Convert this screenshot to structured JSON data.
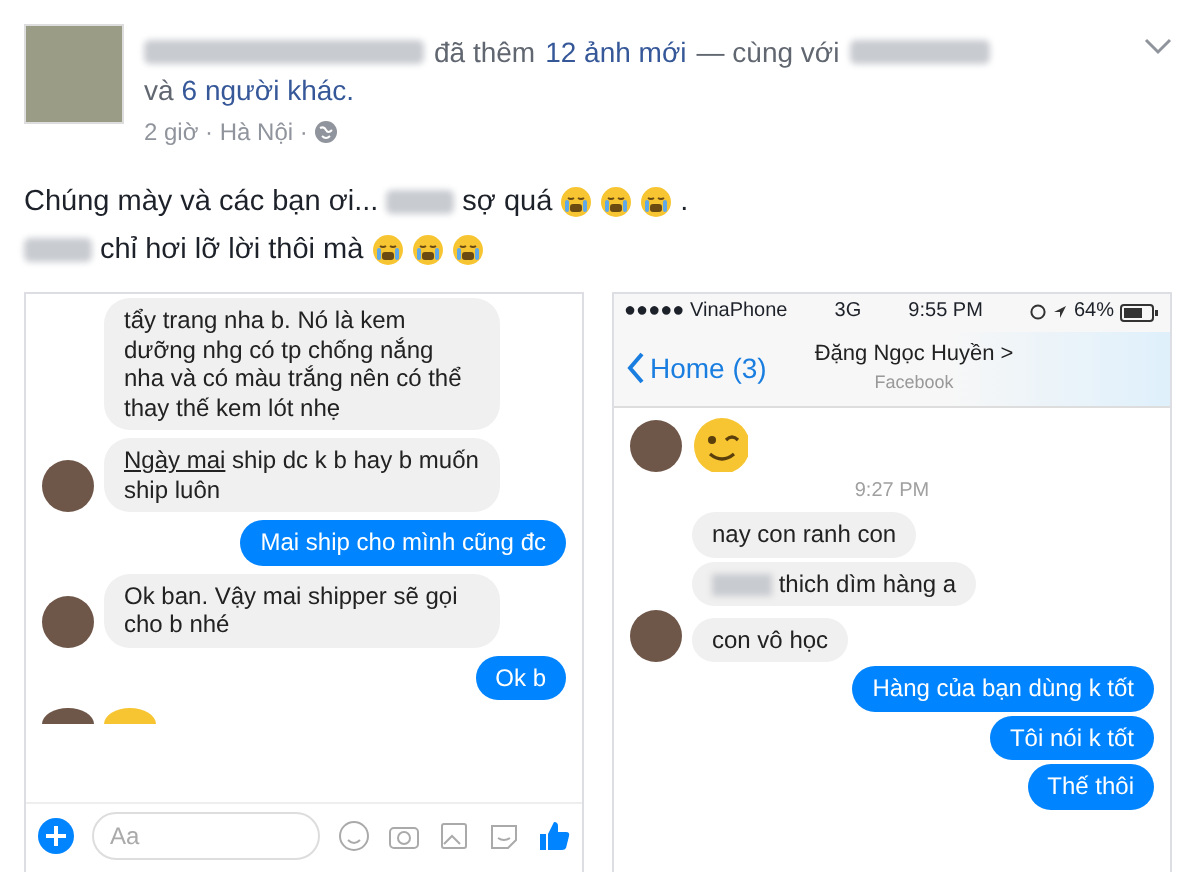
{
  "post": {
    "author": {
      "verb": "đã thêm",
      "photos": "12 ảnh mới",
      "with": "— cùng với",
      "and": "và",
      "others": "6 người khác."
    },
    "meta": "2 giờ · Hà Nội ·",
    "body": [
      [
        {
          "kind": "text",
          "text": "Chúng mày và các bạn ơi..."
        },
        {
          "kind": "redacted"
        },
        {
          "kind": "text",
          "text": "sợ quá"
        },
        {
          "kind": "emoji"
        },
        {
          "kind": "emoji"
        },
        {
          "kind": "emoji"
        },
        {
          "kind": "text",
          "text": "."
        }
      ],
      [
        {
          "kind": "redacted"
        },
        {
          "kind": "text",
          "text": "chỉ hơi lỡ lời thôi mà"
        },
        {
          "kind": "emoji"
        },
        {
          "kind": "emoji"
        },
        {
          "kind": "emoji"
        }
      ]
    ]
  },
  "screenshots": [
    {
      "kind": "messenger",
      "messages": [
        {
          "kind": "incoming",
          "avatar": false,
          "parts": [
            {
              "kind": "text",
              "text": "tẩy trang nha b. Nó là kem dưỡng nhg có tp chống nắng nha và có màu trắng nên có thể thay thế kem lót nhẹ"
            }
          ]
        },
        {
          "kind": "incoming",
          "avatar": true,
          "parts": [
            {
              "kind": "underlined",
              "text": "Ngày mai"
            },
            {
              "kind": "text",
              "text": " ship dc k b hay b muốn ship luôn"
            }
          ]
        },
        {
          "kind": "outgoing",
          "parts": [
            {
              "kind": "text",
              "text": "Mai ship cho mình cũng đc"
            }
          ]
        },
        {
          "kind": "incoming",
          "avatar": true,
          "parts": [
            {
              "kind": "text",
              "text": "Ok ban. Vậy mai shipper sẽ gọi cho b nhé"
            }
          ]
        },
        {
          "kind": "outgoing",
          "parts": [
            {
              "kind": "text",
              "text": "Ok b"
            }
          ]
        },
        {
          "kind": "emoji-cut",
          "avatar": true
        }
      ],
      "composer": {
        "placeholder": "Aa"
      }
    },
    {
      "kind": "ios",
      "status": {
        "carrier": "●●●●● VinaPhone",
        "network": "3G",
        "time": "9:55 PM",
        "battery": "64%"
      },
      "nav": {
        "back": "Home (3)",
        "title": "Đặng Ngọc Huyền >",
        "subtitle": "Facebook"
      },
      "messages": [
        {
          "kind": "emoji",
          "avatar": true
        },
        {
          "kind": "timestamp",
          "text": "9:27 PM"
        },
        {
          "kind": "incoming",
          "avatar": false,
          "parts": [
            {
              "kind": "text",
              "text": "nay con ranh con"
            }
          ]
        },
        {
          "kind": "incoming",
          "avatar": false,
          "parts": [
            {
              "kind": "redacted"
            },
            {
              "kind": "text",
              "text": " thich dìm hàng a"
            }
          ]
        },
        {
          "kind": "incoming",
          "avatar": true,
          "parts": [
            {
              "kind": "text",
              "text": "con vô học"
            }
          ]
        },
        {
          "kind": "outgoing",
          "parts": [
            {
              "kind": "text",
              "text": "Hàng của bạn dùng k tốt"
            }
          ]
        },
        {
          "kind": "outgoing",
          "parts": [
            {
              "kind": "text",
              "text": "Tôi nói k tốt"
            }
          ]
        },
        {
          "kind": "outgoing",
          "parts": [
            {
              "kind": "text",
              "text": "Thế thôi"
            }
          ]
        }
      ]
    }
  ]
}
